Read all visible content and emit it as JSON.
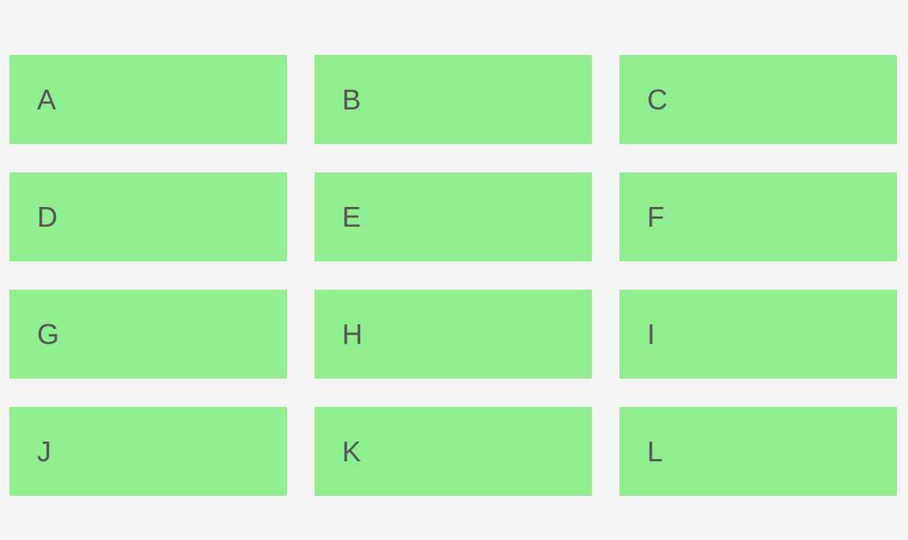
{
  "colors": {
    "background": "#f4f4f4",
    "tile": "#90ee90",
    "text": "#555555"
  },
  "tiles": [
    {
      "label": "A"
    },
    {
      "label": "B"
    },
    {
      "label": "C"
    },
    {
      "label": "D"
    },
    {
      "label": "E"
    },
    {
      "label": "F"
    },
    {
      "label": "G"
    },
    {
      "label": "H"
    },
    {
      "label": "I"
    },
    {
      "label": "J"
    },
    {
      "label": "K"
    },
    {
      "label": "L"
    }
  ]
}
